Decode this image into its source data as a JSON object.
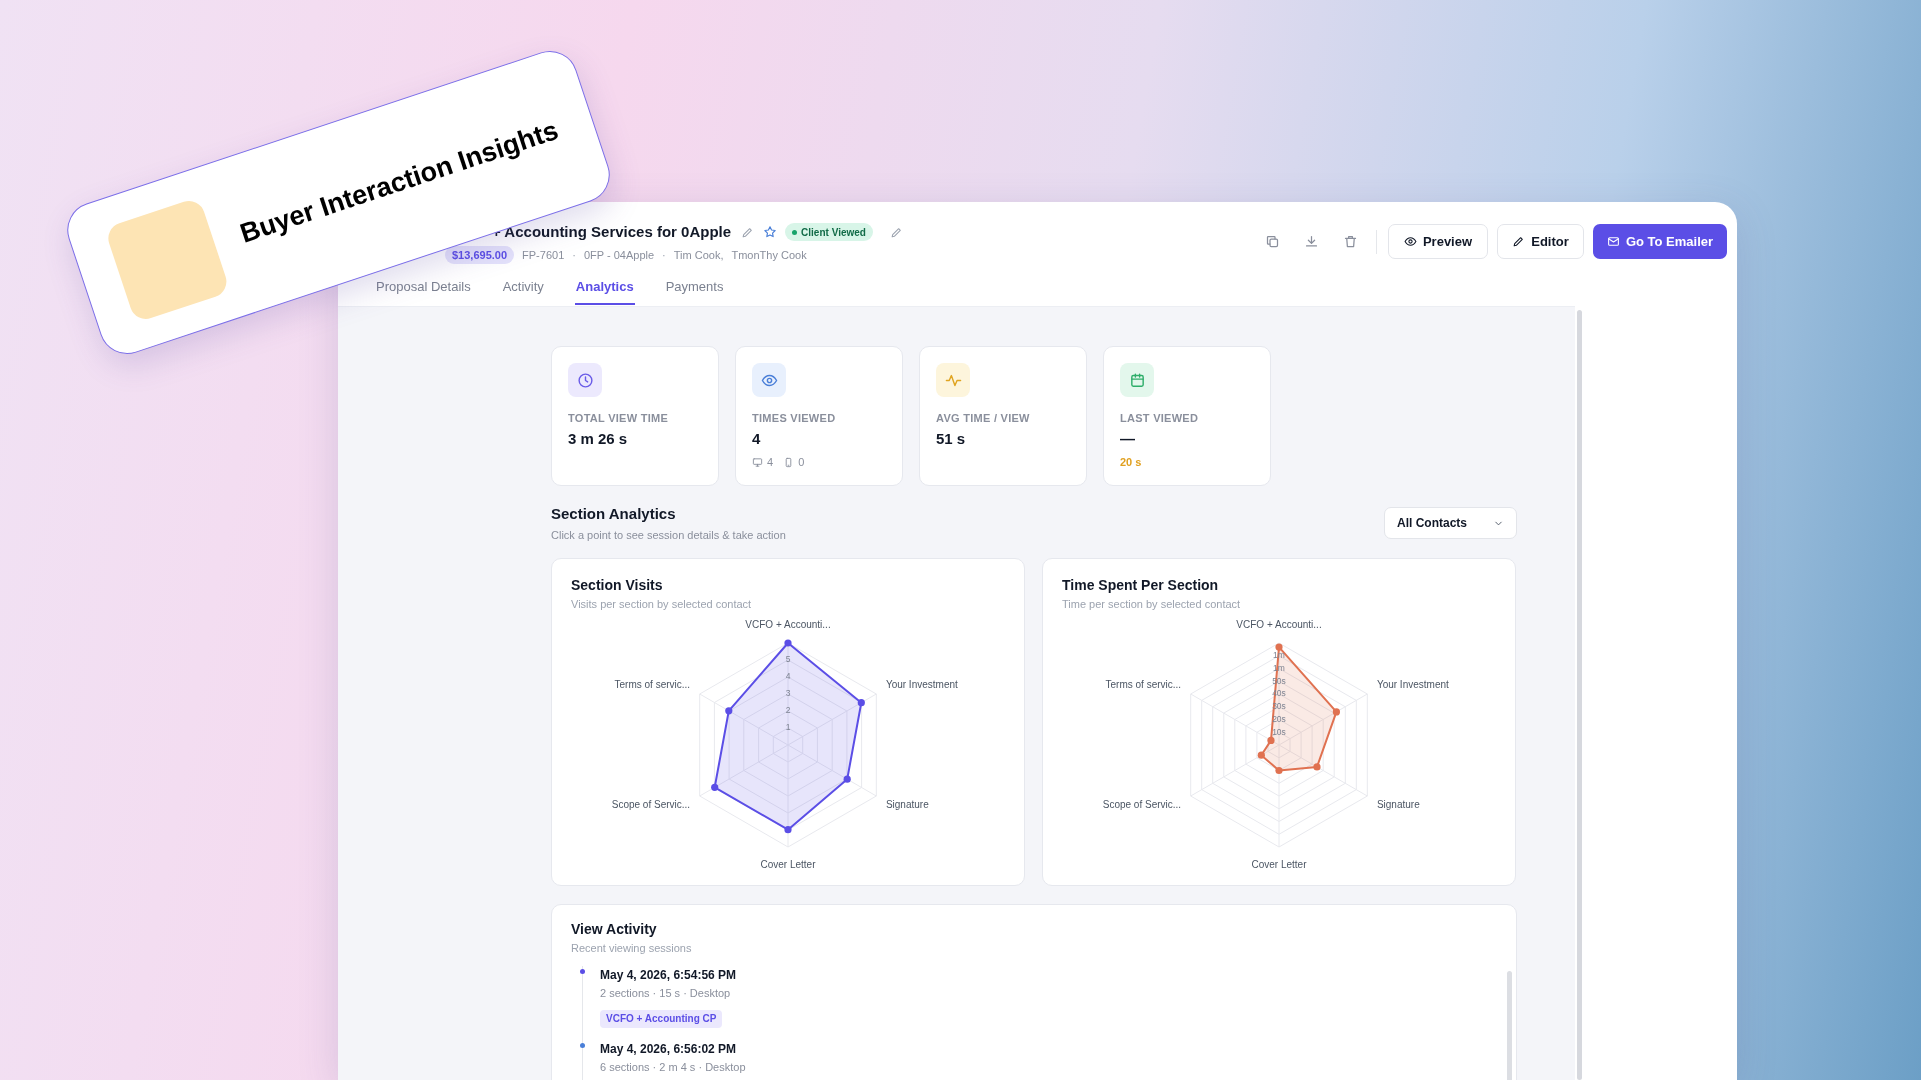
{
  "banner": {
    "title": "Buyer Interaction Insights"
  },
  "header": {
    "title": "+ Accounting Services for 0Apple",
    "starred": false,
    "status": "Client Viewed",
    "amount": "$13,695.00",
    "meta": [
      {
        "kind": "text",
        "text": "FP-7601"
      },
      {
        "kind": "separator",
        "text": "·"
      },
      {
        "kind": "text",
        "text": "0FP - 04Apple"
      },
      {
        "kind": "separator",
        "text": "·"
      },
      {
        "kind": "text",
        "text": "Tim Cook,"
      },
      {
        "kind": "text",
        "text": "TmonThy Cook"
      }
    ],
    "buttons": [
      {
        "kind": "preview",
        "label": "Preview"
      },
      {
        "kind": "edit",
        "label": "Editor"
      },
      {
        "kind": "email",
        "label": "Go To Emailer"
      }
    ],
    "tabs": [
      {
        "label": "Proposal Details",
        "selected": false
      },
      {
        "label": "Activity",
        "selected": false
      },
      {
        "label": "Analytics",
        "selected": true
      },
      {
        "label": "Payments",
        "selected": false
      }
    ]
  },
  "stats": [
    {
      "kind": "clock",
      "label": "TOTAL VIEW TIME",
      "value": "3 m 26 s"
    },
    {
      "kind": "eye",
      "label": "TIMES VIEWED",
      "value": "4",
      "devices": [
        {
          "kind": "desktop",
          "count": "4"
        },
        {
          "kind": "mobile",
          "count": "0"
        }
      ]
    },
    {
      "kind": "pulse",
      "label": "AVG TIME / VIEW",
      "value": "51 s"
    },
    {
      "kind": "calendar",
      "label": "LAST VIEWED",
      "value": "—",
      "note": "20 s"
    }
  ],
  "section_analytics": {
    "title": "Section Analytics",
    "subtitle": "Click a point to see session details & take action",
    "filter": "All Contacts",
    "charts": [
      {
        "title": "Section Visits",
        "subtitle": "Visits per section by selected contact",
        "color": "#5b4ee6",
        "scale": [
          "5",
          "4",
          "3",
          "2",
          "1"
        ],
        "axes": [
          "VCFO + Accounti...",
          "Terms of servic...",
          "Your Investment",
          "Scope of Servic...",
          "Signature",
          "Cover Letter"
        ]
      },
      {
        "title": "Time Spent Per Section",
        "subtitle": "Time per section by selected contact",
        "color": "#e07150",
        "scale": [
          "1m",
          "1m",
          "50s",
          "40s",
          "30s",
          "20s",
          "10s"
        ],
        "axes": [
          "VCFO + Accounti...",
          "Terms of servic...",
          "Your Investment",
          "Scope of Servic...",
          "Signature",
          "Cover Letter"
        ]
      }
    ]
  },
  "view_activity": {
    "title": "View Activity",
    "subtitle": "Recent viewing sessions",
    "sessions": [
      {
        "time": "May 4, 2026, 6:54:56 PM",
        "details": "2 sections · 15 s · Desktop",
        "sections": [
          "VCFO + Accounting CP"
        ],
        "color": "#5b4ee6"
      },
      {
        "time": "May 4, 2026, 6:56:02 PM",
        "details": "6 sections · 2 m 4 s · Desktop",
        "color": "#4a7fd8"
      }
    ]
  }
}
